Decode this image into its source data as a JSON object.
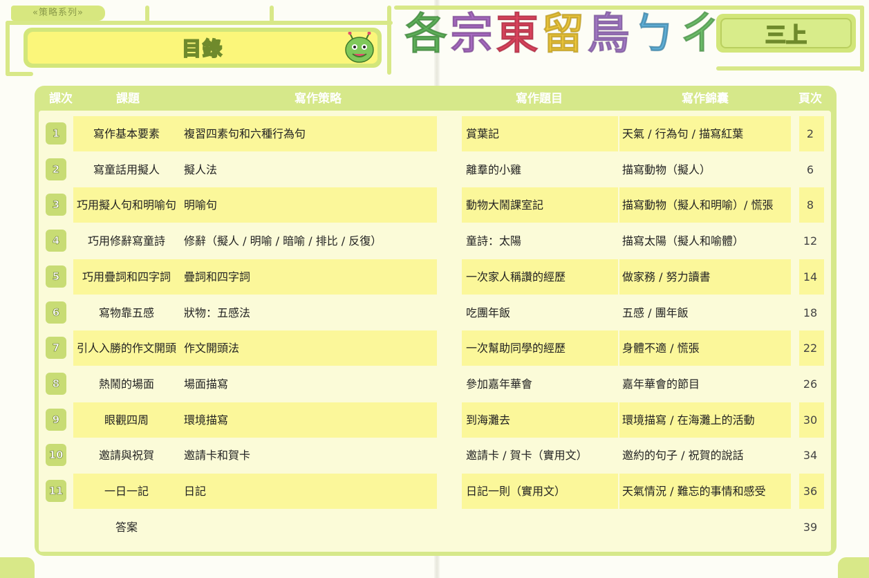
{
  "series_tag": "«策略系列»",
  "toc_title": "目錄",
  "brand_title_chars": [
    "各",
    "宗",
    "東",
    "留",
    "鳥",
    "ㄅ",
    "ㄔ"
  ],
  "brand_colors": [
    "#5fb35a",
    "#a86bc2",
    "#e0455f",
    "#f0c93a",
    "#a57ac8",
    "#5fb0d8",
    "#6ec06b"
  ],
  "grade": "三上",
  "headers": {
    "lesson": "課次",
    "topic": "課題",
    "strategy": "寫作策略",
    "title": "寫作題目",
    "tips": "寫作錦囊",
    "page": "頁次"
  },
  "rows": [
    {
      "num": "1",
      "topic": "寫作基本要素",
      "strategy": "複習四素句和六種行為句",
      "title": "賞葉記",
      "tips": "天氣 / 行為句 / 描寫紅葉",
      "page": "2"
    },
    {
      "num": "2",
      "topic": "寫童話用擬人",
      "strategy": "擬人法",
      "title": "離羣的小雞",
      "tips": "描寫動物（擬人）",
      "page": "6"
    },
    {
      "num": "3",
      "topic": "巧用擬人句和明喻句",
      "strategy": "明喻句",
      "title": "動物大鬧課室記",
      "tips": "描寫動物（擬人和明喻）/ 慌張",
      "page": "8"
    },
    {
      "num": "4",
      "topic": "巧用修辭寫童詩",
      "strategy": "修辭（擬人 / 明喻 / 暗喻 / 排比 / 反復）",
      "title": "童詩：太陽",
      "tips": "描寫太陽（擬人和喻體）",
      "page": "12"
    },
    {
      "num": "5",
      "topic": "巧用疊詞和四字詞",
      "strategy": "疊詞和四字詞",
      "title": "一次家人稱讚的經歷",
      "tips": "做家務 / 努力讀書",
      "page": "14"
    },
    {
      "num": "6",
      "topic": "寫物靠五感",
      "strategy": "狀物：五感法",
      "title": "吃團年飯",
      "tips": "五感 / 團年飯",
      "page": "18"
    },
    {
      "num": "7",
      "topic": "引人入勝的作文開頭",
      "strategy": "作文開頭法",
      "title": "一次幫助同學的經歷",
      "tips": "身體不適 / 慌張",
      "page": "22"
    },
    {
      "num": "8",
      "topic": "熱鬧的場面",
      "strategy": "場面描寫",
      "title": "參加嘉年華會",
      "tips": "嘉年華會的節目",
      "page": "26"
    },
    {
      "num": "9",
      "topic": "眼觀四周",
      "strategy": "環境描寫",
      "title": "到海灘去",
      "tips": "環境描寫 / 在海灘上的活動",
      "page": "30"
    },
    {
      "num": "10",
      "topic": "邀請與祝賀",
      "strategy": "邀請卡和賀卡",
      "title": "邀請卡 / 賀卡（實用文）",
      "tips": "邀約的句子 / 祝賀的說話",
      "page": "34"
    },
    {
      "num": "11",
      "topic": "一日一記",
      "strategy": "日記",
      "title": "日記一則（實用文）",
      "tips": "天氣情況 / 難忘的事情和感受",
      "page": "36"
    },
    {
      "num": "",
      "topic": "答案",
      "strategy": "",
      "title": "",
      "tips": "",
      "page": "39"
    }
  ],
  "colors": {
    "frame": "#d6e88a",
    "row_fill": "#fbf79a",
    "row_alt": "#fbfbd8",
    "badge": "#c8dc74"
  }
}
